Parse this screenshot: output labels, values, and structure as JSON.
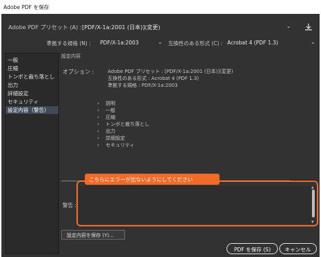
{
  "window": {
    "title": "Adobe PDF を保存"
  },
  "preset": {
    "label": "Adobe PDF プリセット (A) :",
    "value": "[PDF/X-1a:2001 (日本)](変更)"
  },
  "standard": {
    "label": "準拠する規格 (N) :",
    "value": "PDF/X-1a:2003"
  },
  "compat": {
    "label": "互換性のある形式 (C) :",
    "value": "Acrobat 4 (PDF 1.3)"
  },
  "sidebar": {
    "items": [
      {
        "label": "一般"
      },
      {
        "label": "圧縮"
      },
      {
        "label": "トンボと裁ち落とし"
      },
      {
        "label": "出力"
      },
      {
        "label": "詳細設定"
      },
      {
        "label": "セキュリティ"
      },
      {
        "label": "設定内容（警告）"
      }
    ]
  },
  "summary": {
    "header": "設定内容",
    "options_label": "オプション :",
    "lines": [
      "Adobe PDF プリセット : [PDF/X-1a:2001 (日本)](変更)",
      "互換性のある形式 : Acrobat 4 (PDF 1.3)",
      "準拠する規格 : PDF/X-1a:2003"
    ],
    "tree": [
      "説明",
      "一般",
      "圧縮",
      "トンボと裁ち落とし",
      "出力",
      "詳細設定",
      "セキュリティ"
    ]
  },
  "warnings": {
    "label": "警告 :"
  },
  "callout": {
    "text": "こちらにエラーが出ないようにしてください",
    "color": "#f06a28"
  },
  "buttons": {
    "save_summary": "設定内容を保存 (Y)...",
    "save_pdf": "PDF を保存 (S)",
    "cancel": "キャンセル"
  }
}
